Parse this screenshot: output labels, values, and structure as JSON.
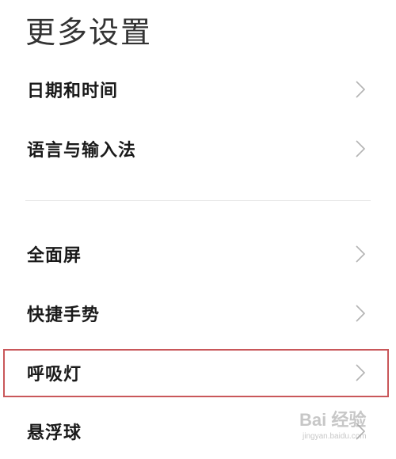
{
  "page": {
    "title": "更多设置"
  },
  "items": [
    {
      "label": "日期和时间"
    },
    {
      "label": "语言与输入法"
    },
    {
      "label": "全面屏"
    },
    {
      "label": "快捷手势"
    },
    {
      "label": "呼吸灯"
    },
    {
      "label": "悬浮球"
    }
  ],
  "colors": {
    "highlight_border": "#c9575a",
    "chevron": "#b3b3b3",
    "divider": "#e6e6e6"
  },
  "icons": {
    "chevron": "chevron-right-icon"
  },
  "watermark": {
    "text": "Bai 经验",
    "url_text": "jingyan.baidu.com"
  }
}
